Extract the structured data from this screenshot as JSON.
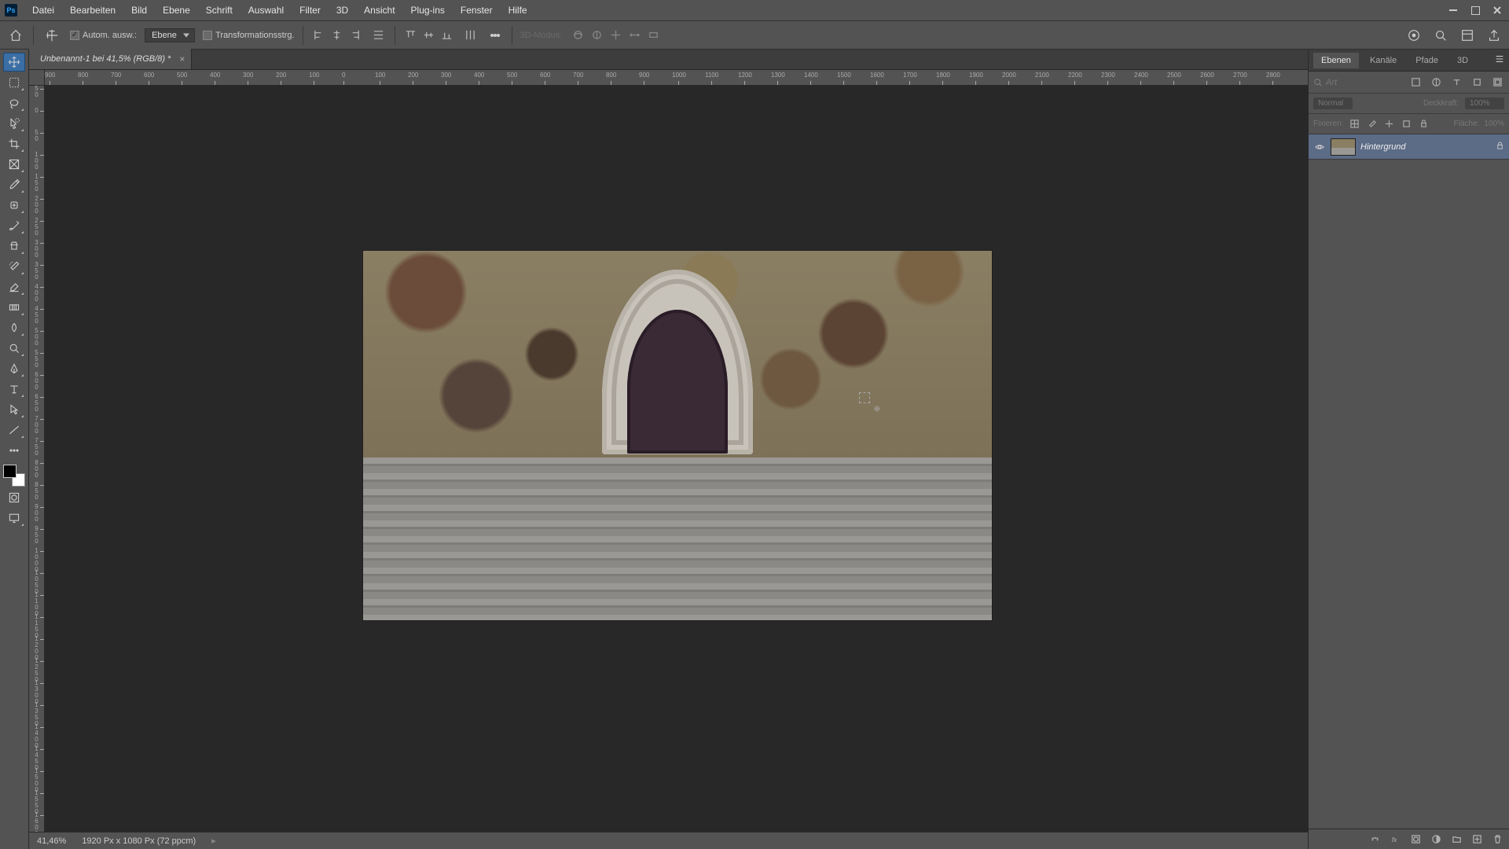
{
  "app": {
    "logo_text": "Ps"
  },
  "menu": {
    "items": [
      "Datei",
      "Bearbeiten",
      "Bild",
      "Ebene",
      "Schrift",
      "Auswahl",
      "Filter",
      "3D",
      "Ansicht",
      "Plug-ins",
      "Fenster",
      "Hilfe"
    ]
  },
  "options": {
    "auto_select_label": "Autom. ausw.:",
    "auto_select_type": "Ebene",
    "transform_label": "Transformationsstrg.",
    "mode_3d_label": "3D-Modus:"
  },
  "doc": {
    "tab_title": "Unbenannt-1 bei 41,5% (RGB/8) *"
  },
  "rulers": {
    "h_ticks": [
      "900",
      "800",
      "700",
      "600",
      "500",
      "400",
      "300",
      "200",
      "100",
      "0",
      "100",
      "200",
      "300",
      "400",
      "500",
      "600",
      "700",
      "800",
      "900",
      "1000",
      "1100",
      "1200",
      "1300",
      "1400",
      "1500",
      "1600",
      "1700",
      "1800",
      "1900",
      "2000",
      "2100",
      "2200",
      "2300",
      "2400",
      "2500",
      "2600",
      "2700",
      "2800"
    ],
    "v_ticks": [
      "50",
      "0",
      "50",
      "100",
      "150",
      "200",
      "250",
      "300",
      "350",
      "400",
      "450",
      "500",
      "550",
      "600",
      "650",
      "700",
      "750",
      "800",
      "850",
      "900",
      "950",
      "1000",
      "1050",
      "1100",
      "1150",
      "1200",
      "1250",
      "1300",
      "1350",
      "1400",
      "1450",
      "1500",
      "1550",
      "1600"
    ]
  },
  "status": {
    "zoom": "41,46%",
    "doc_info": "1920 Px x 1080 Px (72 ppcm)"
  },
  "panels": {
    "tabs": [
      "Ebenen",
      "Kanäle",
      "Pfade",
      "3D"
    ],
    "search_placeholder": "Art",
    "blend_mode": "Normal",
    "opacity_label": "Deckkraft:",
    "opacity_value": "100%",
    "lock_label": "Fixieren:",
    "fill_label": "Fläche:",
    "fill_value": "100%",
    "layers": [
      {
        "name": "Hintergrund"
      }
    ]
  }
}
